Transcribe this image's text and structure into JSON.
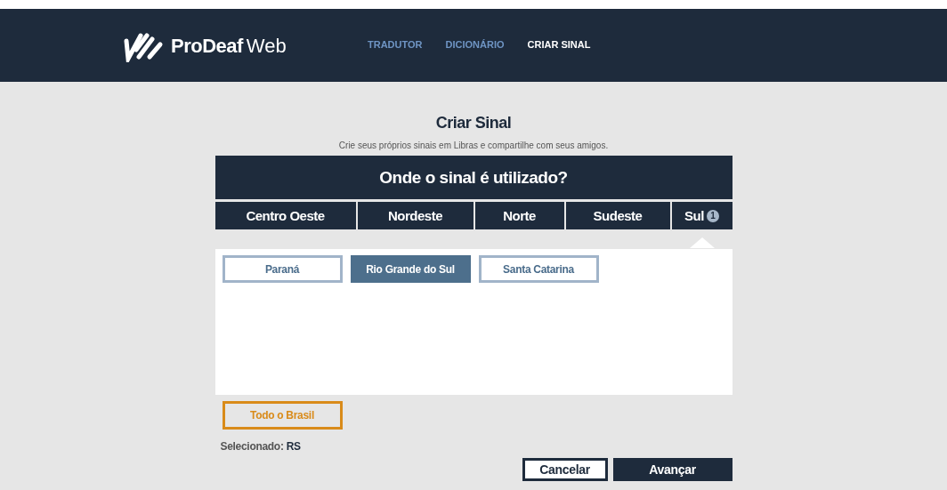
{
  "header": {
    "logo_text": "ProDeaf",
    "logo_suffix": "Web",
    "nav": [
      {
        "label": "TRADUTOR",
        "selected": false
      },
      {
        "label": "DICIONÁRIO",
        "selected": false
      },
      {
        "label": "CRIAR SINAL",
        "selected": true
      }
    ]
  },
  "page": {
    "title": "Criar Sinal",
    "subtitle": "Crie seus próprios sinais em Libras e compartilhe com seus amigos."
  },
  "question": "Onde o sinal é utilizado?",
  "regions": [
    {
      "label": "Centro Oeste",
      "selected": false
    },
    {
      "label": "Nordeste",
      "selected": false
    },
    {
      "label": "Norte",
      "selected": false
    },
    {
      "label": "Sudeste",
      "selected": false
    },
    {
      "label": "Sul",
      "selected": true,
      "badge": "1"
    }
  ],
  "states": [
    {
      "label": "Paraná",
      "selected": false
    },
    {
      "label": "Rio Grande do Sul",
      "selected": true
    },
    {
      "label": "Santa Catarina",
      "selected": false
    }
  ],
  "all_button": "Todo o Brasil",
  "selection": {
    "label": "Selecionado:",
    "value": "RS"
  },
  "buttons": [
    {
      "label": "Cancelar",
      "kind": "secondary"
    },
    {
      "label": "Avançar",
      "kind": "primary"
    }
  ]
}
